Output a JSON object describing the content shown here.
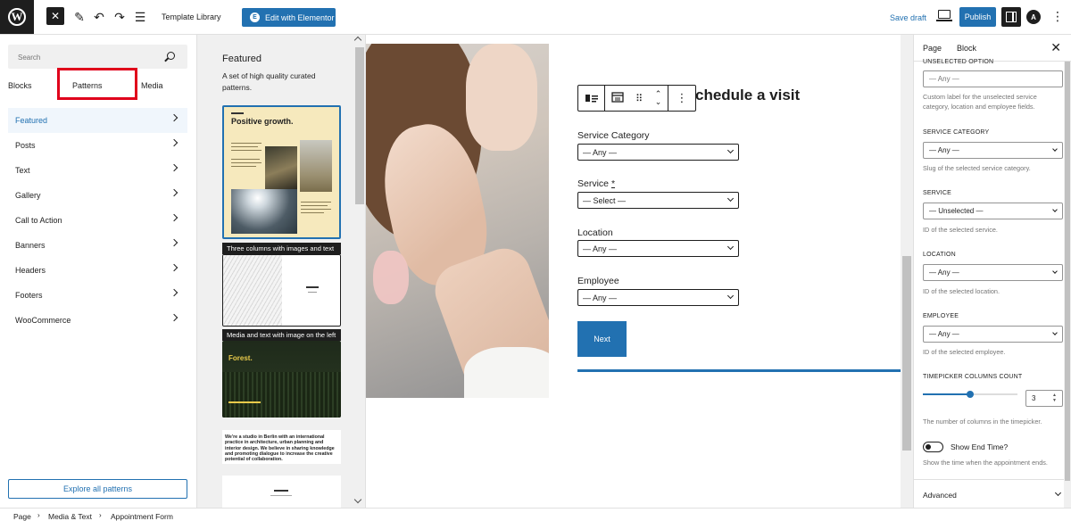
{
  "topbar": {
    "template_library": "Template Library",
    "edit_elementor": "Edit with Elementor",
    "save_draft": "Save draft",
    "publish": "Publish",
    "icons": [
      "wordpress-logo-icon",
      "close-icon",
      "pen-tool-icon",
      "undo-icon",
      "redo-icon",
      "list-view-icon",
      "desktop-preview-icon",
      "settings-panel-icon",
      "astra-icon",
      "more-options-icon"
    ]
  },
  "inserter": {
    "search_placeholder": "Search",
    "tabs": [
      "Blocks",
      "Patterns",
      "Media"
    ],
    "active_tab": "Patterns",
    "categories": [
      "Featured",
      "Posts",
      "Text",
      "Gallery",
      "Call to Action",
      "Banners",
      "Headers",
      "Footers",
      "WooCommerce"
    ],
    "active_category": "Featured",
    "explore_label": "Explore all patterns"
  },
  "patterns": {
    "title": "Featured",
    "description": "A set of high quality curated patterns.",
    "card1_title": "Positive growth.",
    "caption1": "Three columns with images and text",
    "caption2": "Media and text with image on the left",
    "card3_title": "Forest.",
    "card4_text": "We're a studio in Berlin with an international practice in architecture, urban planning and interior design. We believe in sharing knowledge and promoting dialogue to increase the creative potential of collaboration."
  },
  "canvas": {
    "heading": "chedule a visit",
    "fields": [
      {
        "label": "Service Category",
        "required": "",
        "value": "— Any —"
      },
      {
        "label": "Service",
        "required": "*",
        "value": "— Select —"
      },
      {
        "label": "Location",
        "required": "",
        "value": "— Any —"
      },
      {
        "label": "Employee",
        "required": "",
        "value": "— Any —"
      }
    ],
    "next_button": "Next"
  },
  "sidebar": {
    "tabs": [
      "Page",
      "Block"
    ],
    "active_tab": "Block",
    "unselected_label": "UNSELECTED OPTION",
    "unselected_placeholder": "— Any —",
    "unselected_help": "Custom label for the unselected service category, location and employee fields.",
    "service_category": {
      "label": "SERVICE CATEGORY",
      "value": "— Any —",
      "help": "Slug of the selected service category."
    },
    "service": {
      "label": "SERVICE",
      "value": "— Unselected —",
      "help": "ID of the selected service."
    },
    "location": {
      "label": "LOCATION",
      "value": "— Any —",
      "help": "ID of the selected location."
    },
    "employee": {
      "label": "EMPLOYEE",
      "value": "— Any —",
      "help": "ID of the selected employee."
    },
    "timepicker": {
      "label": "TIMEPICKER COLUMNS COUNT",
      "value": "3",
      "fraction": 0.5,
      "help": "The number of columns in the timepicker."
    },
    "show_end_time": {
      "label": "Show End Time?",
      "checked": false,
      "help": "Show the time when the appointment ends."
    },
    "advanced": "Advanced"
  },
  "breadcrumb": [
    "Page",
    "Media & Text",
    "Appointment Form"
  ],
  "colors": {
    "accent": "#2271b1",
    "highlight": "#e0001b",
    "dark": "#1e1e1e"
  }
}
